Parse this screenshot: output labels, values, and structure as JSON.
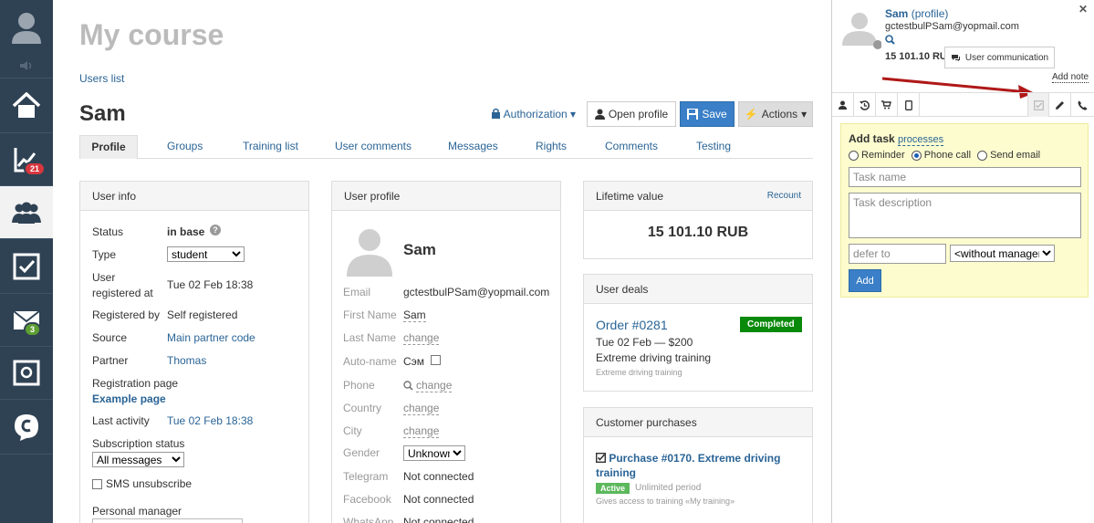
{
  "nav": {
    "items": [
      {
        "icon": "user-avatar-icon"
      },
      {
        "icon": "sound-icon"
      },
      {
        "icon": "home-icon"
      },
      {
        "icon": "chart-icon",
        "badge": "21",
        "badge_color": "#d9363e"
      },
      {
        "icon": "users-icon"
      },
      {
        "icon": "tasks-checkbox-icon"
      },
      {
        "icon": "mail-icon",
        "badge": "3",
        "badge_color": "#5d9e32"
      },
      {
        "icon": "safe-icon"
      },
      {
        "icon": "chat-icon"
      }
    ]
  },
  "page": {
    "title": "My course",
    "users_list": "Users list",
    "user_name": "Sam",
    "authorization": "Authorization",
    "open_profile": "Open profile",
    "save": "Save",
    "actions": "Actions"
  },
  "tabs": [
    "Profile",
    "Groups",
    "Training list",
    "User comments",
    "Messages",
    "Rights",
    "Comments",
    "Testing"
  ],
  "user_info": {
    "title": "User info",
    "status_label": "Status",
    "status_value": "in base",
    "type_label": "Type",
    "type_value": "student",
    "registered_label_1": "User",
    "registered_label_2": "registered at",
    "registered_value": "Tue 02 Feb 18:38",
    "registered_by_label": "Registered by",
    "registered_by_value": "Self registered",
    "source_label": "Source",
    "source_value": "Main partner code",
    "partner_label": "Partner",
    "partner_value": "Thomas",
    "reg_page_label": "Registration page",
    "reg_page_value": "Example page",
    "last_activity_label": "Last activity",
    "last_activity_value": "Tue 02 Feb 18:38",
    "subscription_label": "Subscription status",
    "subscription_value": "All messages",
    "sms_label": "SMS unsubscribe",
    "manager_label": "Personal manager"
  },
  "user_profile": {
    "title": "User profile",
    "name": "Sam",
    "email_label": "Email",
    "email_value": "gctestbulPSam@yopmail.com",
    "first_name_label": "First Name",
    "first_name_value": "Sam",
    "last_name_label": "Last Name",
    "last_name_value": "change",
    "auto_name_label": "Auto-name",
    "auto_name_value": "Сэм",
    "phone_label": "Phone",
    "phone_value": "change",
    "country_label": "Country",
    "country_value": "change",
    "city_label": "City",
    "city_value": "change",
    "gender_label": "Gender",
    "gender_value": "Unknown",
    "telegram_label": "Telegram",
    "telegram_value": "Not connected",
    "facebook_label": "Facebook",
    "facebook_value": "Not connected",
    "whatsapp_label": "WhatsApp",
    "whatsapp_value": "Not connected"
  },
  "lifetime": {
    "title": "Lifetime value",
    "recount": "Recount",
    "value": "15 101.10 RUB"
  },
  "deals": {
    "title": "User deals",
    "order": "Order #0281",
    "status": "Completed",
    "status_color": "#0a8a0a",
    "date_price": "Tue 02 Feb — $200",
    "product": "Extreme driving training",
    "sub": "Extreme driving training"
  },
  "purchases": {
    "title": "Customer purchases",
    "name": "Purchase #0170. Extreme driving training",
    "status": "Active",
    "status_color": "#5cb85c",
    "period": "Unlimited period",
    "access": "Gives access to training «My training»"
  },
  "right": {
    "name": "Sam",
    "profile_link": "(profile)",
    "email": "gctestbulPSam@yopmail.com",
    "ltv": "15 101.10 RUB",
    "user_communication": "User communication",
    "add_note": "Add note",
    "tabs": [
      "person-icon",
      "history-icon",
      "cart-icon",
      "mobile-icon",
      "task-icon",
      "pencil-icon",
      "phone-icon"
    ],
    "add_task": "Add task",
    "processes": "processes",
    "reminder": "Reminder",
    "phone_call": "Phone call",
    "send_email": "Send email",
    "task_name_ph": "Task name",
    "task_desc_ph": "Task description",
    "defer_ph": "defer to",
    "manager": "<without manager>",
    "add_btn": "Add"
  }
}
